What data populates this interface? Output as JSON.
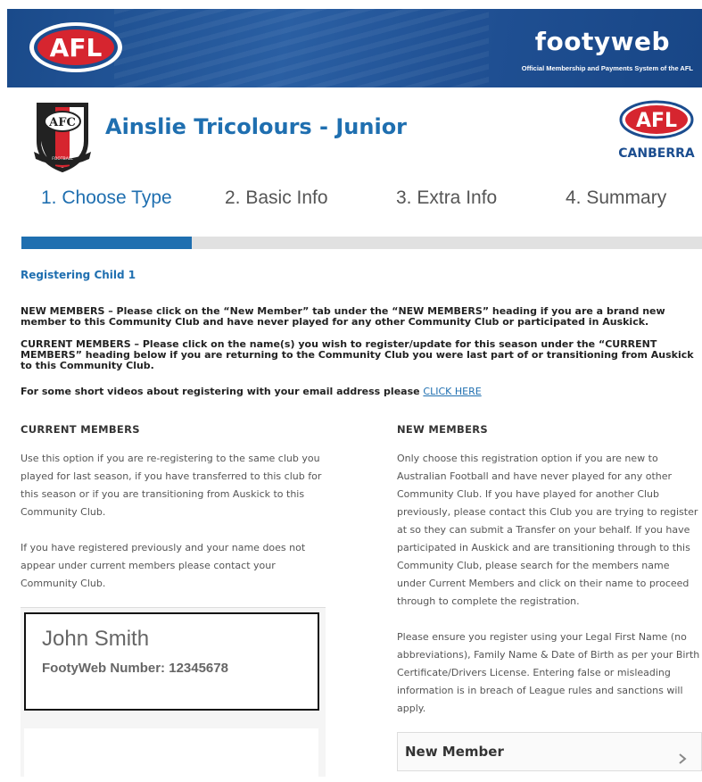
{
  "header": {
    "brand_logo_text": "AFL",
    "site_title": "footyweb",
    "site_subtitle": "Official Membership and Payments System of the AFL",
    "brand_color": "#1f4f92"
  },
  "club": {
    "name": "Ainslie Tricolours - Junior",
    "crest_text": "AFC",
    "crest_ribbon": "FOOTBALL",
    "partner_logo_text": "AFL",
    "partner_logo_sub": "CANBERRA"
  },
  "steps": [
    {
      "label": "1. Choose Type",
      "active": true
    },
    {
      "label": "2. Basic Info",
      "active": false
    },
    {
      "label": "3. Extra Info",
      "active": false
    },
    {
      "label": "4. Summary",
      "active": false
    }
  ],
  "progress": {
    "fraction": 0.25,
    "color": "#1f6fb0"
  },
  "registering_label": "Registering Child 1",
  "notices": {
    "new_members": "NEW MEMBERS – Please click on the “New Member” tab under the “NEW MEMBERS” heading if you are a brand new member to this Community Club and have never played for any other Community Club or participated in Auskick.",
    "current_members": "CURRENT MEMBERS – Please click on the name(s) you wish to register/update for this season under the “CURRENT MEMBERS” heading below if you are returning to the Community Club you were last part of or transitioning from Auskick to this Community Club.",
    "videos_text": "For some short videos about registering with your email address please ",
    "videos_link": "CLICK HERE"
  },
  "current_members": {
    "heading": "CURRENT MEMBERS",
    "para1": "Use this option if you are re-registering to the same club you played for last season, if you have transferred to this club for this season or if you are transitioning from Auskick to this Community Club.",
    "para2": "If you have registered previously and your name does not appear under current members please contact your Community Club.",
    "member": {
      "name": "John Smith",
      "number_label": "FootyWeb Number: 12345678"
    }
  },
  "new_members": {
    "heading": "NEW MEMBERS",
    "para1": "Only choose this registration option if you are new to Australian Football and have never played for any other Community Club. If you have played for another Club previously, please contact this Club you are trying to register at so they can submit a Transfer on your behalf. If you have participated in Auskick and are transitioning through to this Community Club, please search for the members name under Current Members and click on their name to proceed through to complete the registration.",
    "para2": "Please ensure you register using your Legal First Name (no abbreviations), Family Name & Date of Birth as per your Birth Certificate/Drivers License. Entering false or misleading information is in breach of League rules and sanctions will apply.",
    "button_label": "New Member"
  },
  "icons": {
    "afl_logo": "afl-logo-icon",
    "club_crest": "club-crest-icon",
    "canberra_logo": "afl-canberra-logo-icon",
    "chevron": "chevron-right-icon"
  }
}
